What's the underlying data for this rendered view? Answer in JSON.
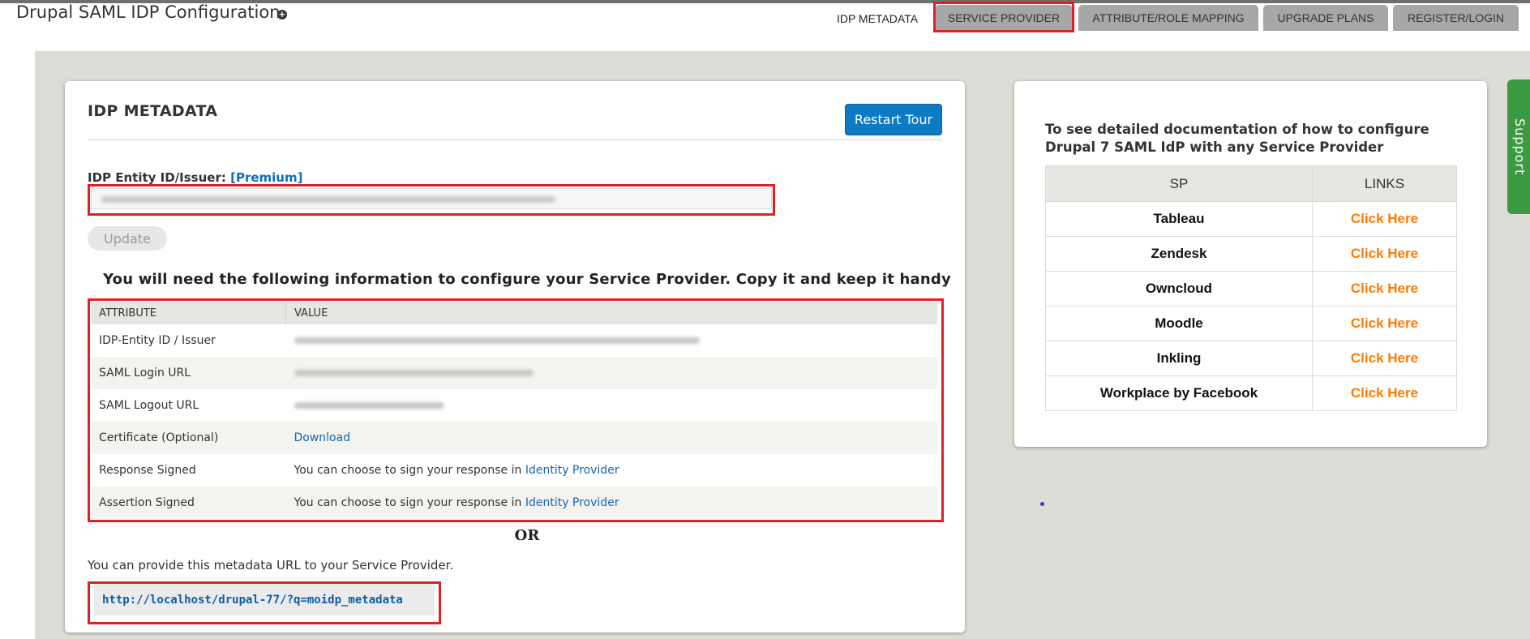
{
  "header": {
    "title": "Drupal SAML IDP Configuration",
    "add_icon": "+",
    "tabs": [
      {
        "label": "IDP METADATA",
        "active": true
      },
      {
        "label": "SERVICE PROVIDER",
        "active": false
      },
      {
        "label": "ATTRIBUTE/ROLE MAPPING",
        "active": false
      },
      {
        "label": "UPGRADE PLANS",
        "active": false
      },
      {
        "label": "REGISTER/LOGIN",
        "active": false
      }
    ]
  },
  "idp_card": {
    "title": "IDP METADATA",
    "restart_tour": "Restart Tour",
    "entity_label": "IDP Entity ID/Issuer:",
    "premium": "[Premium]",
    "update_button": "Update",
    "info_heading": "You will need the following information to configure your Service Provider. Copy it and keep it handy",
    "table": {
      "headers": [
        "ATTRIBUTE",
        "VALUE"
      ],
      "rows": [
        {
          "attribute": "IDP-Entity ID / Issuer"
        },
        {
          "attribute": "SAML Login URL"
        },
        {
          "attribute": "SAML Logout URL"
        },
        {
          "attribute": "Certificate (Optional)",
          "link": "Download"
        },
        {
          "attribute": "Response Signed",
          "text": "You can choose to sign your response in",
          "link": "Identity Provider"
        },
        {
          "attribute": "Assertion Signed",
          "text": "You can choose to sign your response in",
          "link": "Identity Provider"
        }
      ]
    },
    "or_text": "OR",
    "metadata_note": "You can provide this metadata URL to your Service Provider.",
    "metadata_url": "http://localhost/drupal-77/?q=moidp_metadata"
  },
  "docs_card": {
    "heading": "To see detailed documentation of how to configure Drupal 7 SAML IdP with any Service Provider",
    "headers": [
      "SP",
      "LINKS"
    ],
    "rows": [
      {
        "sp": "Tableau",
        "link": "Click Here"
      },
      {
        "sp": "Zendesk",
        "link": "Click Here"
      },
      {
        "sp": "Owncloud",
        "link": "Click Here"
      },
      {
        "sp": "Moodle",
        "link": "Click Here"
      },
      {
        "sp": "Inkling",
        "link": "Click Here"
      },
      {
        "sp": "Workplace by Facebook",
        "link": "Click Here"
      }
    ]
  },
  "support": {
    "label": "Support"
  },
  "colors": {
    "highlight": "#e21f26",
    "primary_button": "#0d7bc4",
    "link": "#1269b0",
    "sp_link": "#ff7a00",
    "support": "#3c9a43"
  }
}
